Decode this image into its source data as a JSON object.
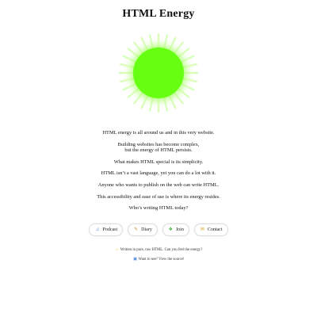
{
  "page": {
    "title": "HTML Energy"
  },
  "colors": {
    "sun_core": "#66ff11",
    "sun_glow": "#b4ff7a",
    "button_border": "#dddddd"
  },
  "body": {
    "lines": [
      "HTML energy is all around us and in this very website.",
      "Building websites has become complex,",
      "but the energy of HTML persists.",
      "What makes HTML special is its simplicity.",
      "HTML isn’t a vast language, yet you can do a lot with it.",
      "Anyone who wants to publish on the web can write HTML.",
      "This accessibility and ease of use is where its energy resides.",
      "Who’s writing HTML today?"
    ]
  },
  "nav": {
    "buttons": [
      {
        "label": "Podcast",
        "icon": "music-note-icon",
        "glyph": "♫"
      },
      {
        "label": "Diary",
        "icon": "notebook-icon",
        "glyph": "✎"
      },
      {
        "label": "Join",
        "icon": "join-icon",
        "glyph": "❖"
      },
      {
        "label": "Contact",
        "icon": "envelope-icon",
        "glyph": "✉"
      }
    ]
  },
  "footer": {
    "written_text": "Written in pure, raw HTML. Can you feel the energy?",
    "written_icon": "sun-icon",
    "written_glyph": "☼",
    "source_text": "Want to see? View the source!",
    "source_icon": "computer-icon",
    "source_glyph": "▣"
  }
}
